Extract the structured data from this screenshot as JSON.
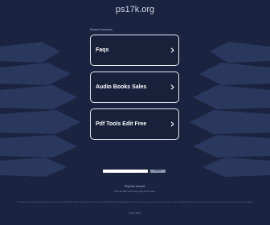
{
  "domain": "ps17k.org",
  "related_label": "Related Searches",
  "links": [
    {
      "label": "Faqs"
    },
    {
      "label": "Audio Books Sales"
    },
    {
      "label": "Pdf Tools Edit Free"
    }
  ],
  "search": {
    "placeholder": "",
    "button_label": "Search"
  },
  "footer": {
    "buy_text": "Buy this domain",
    "inquire_text": "The domain ps17k.org may be for sale.",
    "disclaimer": "This webpage was generated by the domain owner using Sedo Domain Parking. Disclaimer: Sedo maintains no relationship with third party advertisers. Reference to any specific service or trade mark is not controlled by Sedo nor does it constitute or imply its association, endorsement or recommendation.",
    "privacy_text": "Privacy Policy"
  },
  "colors": {
    "background": "#1a2340",
    "box_border": "#e6e9f2"
  }
}
